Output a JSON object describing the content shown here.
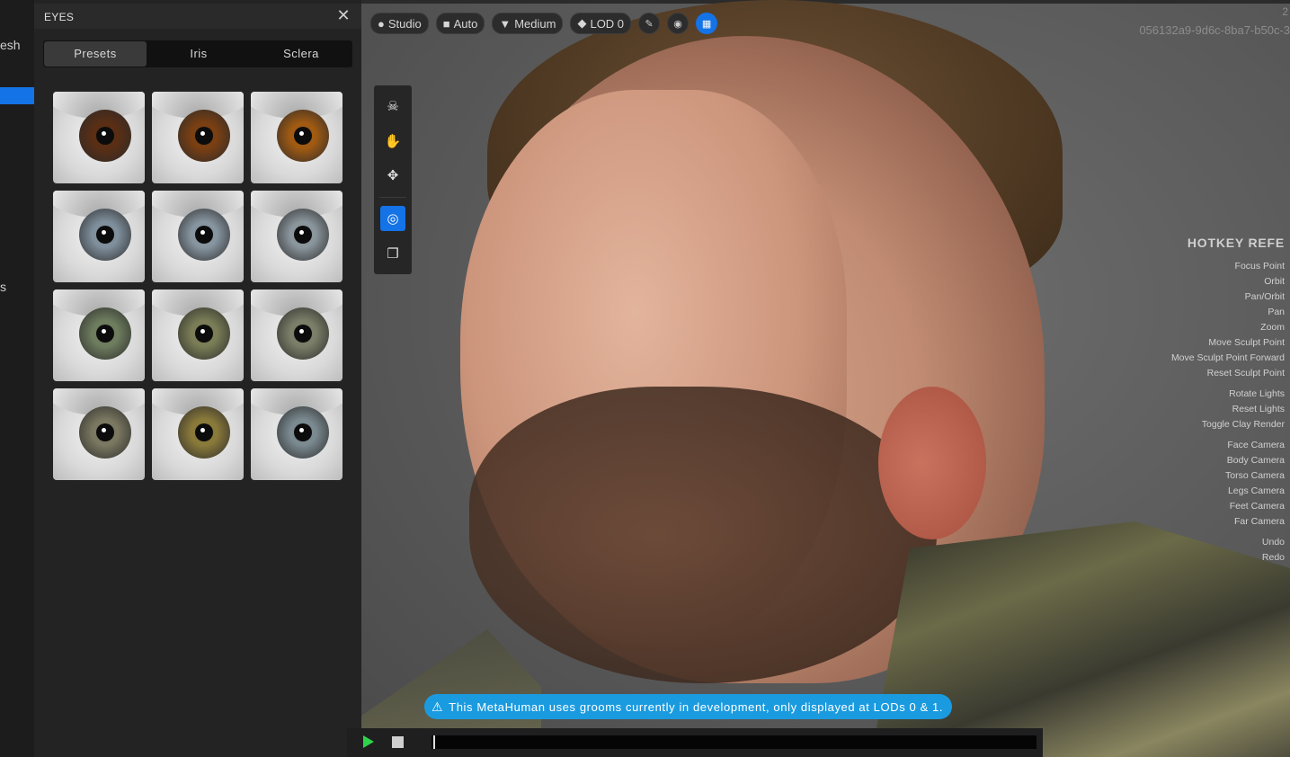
{
  "sidebar": {
    "cut_text_1": "esh",
    "cut_text_2": "s"
  },
  "eyes_panel": {
    "title": "EYES",
    "close_icon": "close-icon",
    "tabs": [
      {
        "label": "Presets",
        "active": true
      },
      {
        "label": "Iris",
        "active": false
      },
      {
        "label": "Sclera",
        "active": false
      }
    ],
    "presets": [
      {
        "iris_color": "#5a2e14"
      },
      {
        "iris_color": "#7a3f12"
      },
      {
        "iris_color": "#a05a12"
      },
      {
        "iris_color": "#7f8f9c"
      },
      {
        "iris_color": "#8795a0"
      },
      {
        "iris_color": "#8a959c"
      },
      {
        "iris_color": "#6e7d5e"
      },
      {
        "iris_color": "#7a7d56"
      },
      {
        "iris_color": "#7b7e68"
      },
      {
        "iris_color": "#7a7860"
      },
      {
        "iris_color": "#8a7a3a"
      },
      {
        "iris_color": "#7a8a90"
      }
    ]
  },
  "viewport": {
    "toolbar": {
      "studio_label": "Studio",
      "auto_label": "Auto",
      "medium_label": "Medium",
      "lod_label": "LOD 0",
      "icons": [
        "brush-icon",
        "globe-icon",
        "keyboard-icon"
      ]
    },
    "guid": "056132a9-9d6c-8ba7-b50c-3",
    "guid_top": "2",
    "hotkeys": {
      "title": "HOTKEY REFE",
      "groups": [
        [
          "Focus Point",
          "Orbit",
          "Pan/Orbit",
          "Pan",
          "Zoom",
          "Move Sculpt Point",
          "Move Sculpt Point Forward",
          "Reset Sculpt Point"
        ],
        [
          "Rotate Lights",
          "Reset Lights",
          "Toggle Clay Render"
        ],
        [
          "Face Camera",
          "Body Camera",
          "Torso Camera",
          "Legs Camera",
          "Feet Camera",
          "Far Camera"
        ],
        [
          "Undo",
          "Redo"
        ]
      ]
    },
    "banner": "This MetaHuman uses grooms currently in development, only displayed at LODs 0 & 1.",
    "accent": "#1473e6"
  }
}
